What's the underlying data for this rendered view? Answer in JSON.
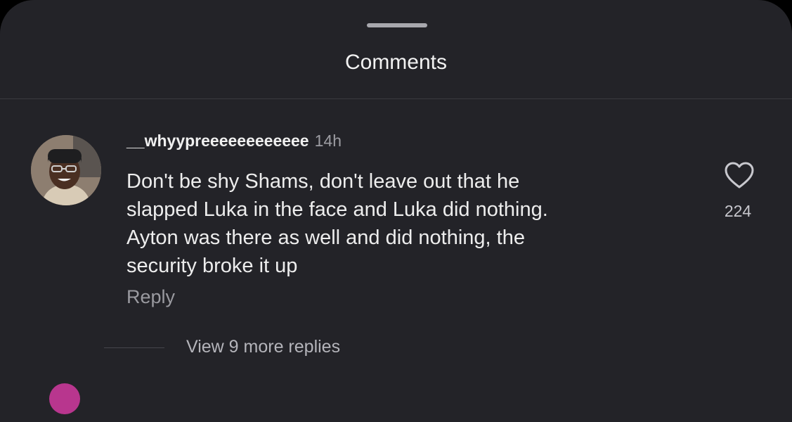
{
  "sheet": {
    "title": "Comments"
  },
  "comment": {
    "username": "__whyypreeeeeeeeeeee",
    "timestamp": "14h",
    "text_lines": [
      "Don't be shy Shams, don't leave out that he",
      "slapped Luka in the face and Luka did nothing.",
      "Ayton was there as well and did nothing, the",
      "security broke it up"
    ],
    "reply_label": "Reply",
    "like_count": "224",
    "like_icon": "heart-outline-icon",
    "view_replies_label": "View 9 more replies"
  },
  "colors": {
    "sheet_background": "#232328",
    "primary_text": "#ededed",
    "secondary_text": "#9a9aa0",
    "next_avatar": "#b8368e"
  }
}
